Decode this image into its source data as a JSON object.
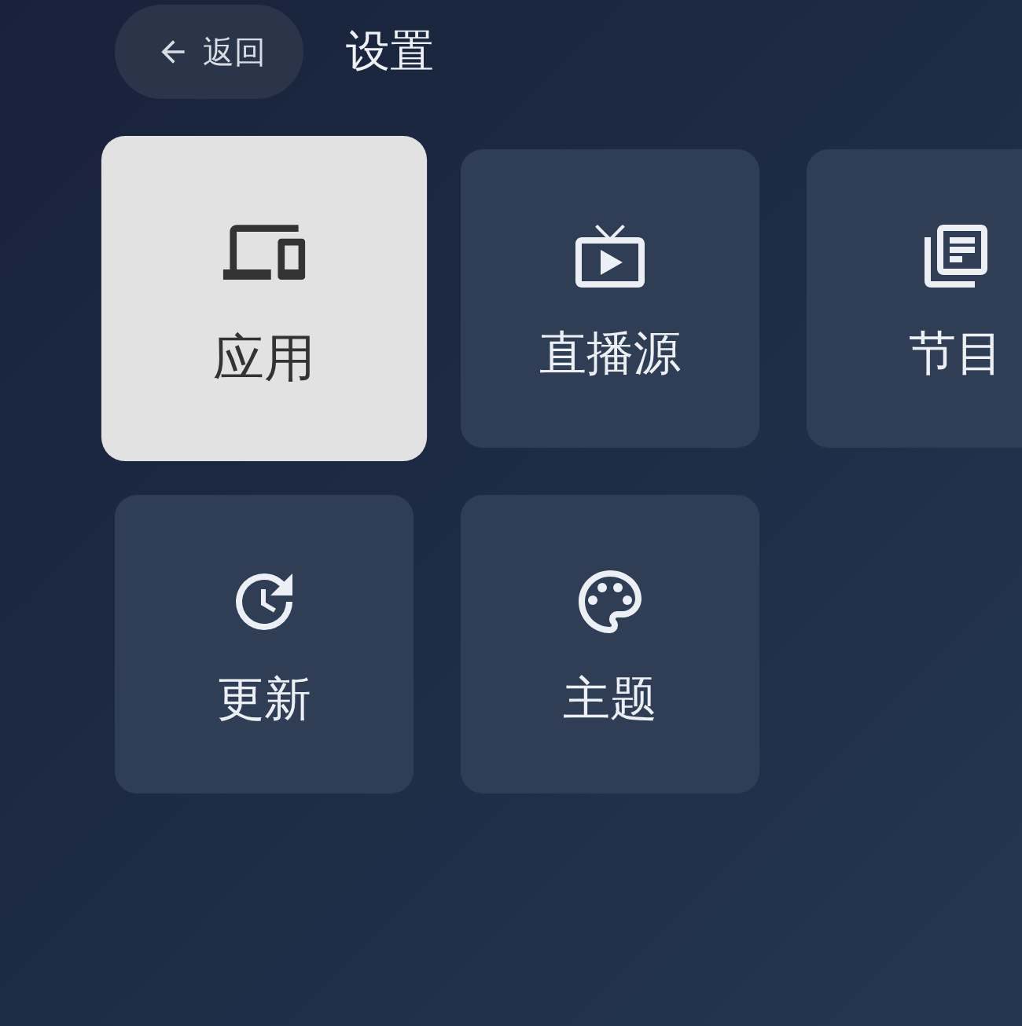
{
  "back_button": {
    "label": "返回"
  },
  "title": "设置",
  "tiles": [
    {
      "label": "应用",
      "selected": true
    },
    {
      "label": "直播源",
      "selected": false
    },
    {
      "label": "节目",
      "selected": false
    },
    {
      "label": "更新",
      "selected": false
    },
    {
      "label": "主题",
      "selected": false
    }
  ]
}
